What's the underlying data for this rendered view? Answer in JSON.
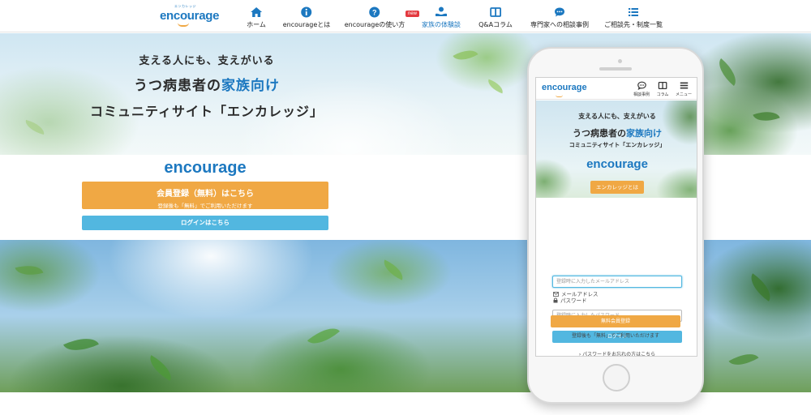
{
  "header": {
    "logo_text": "encourage",
    "logo_tagline": "エンカレッジ",
    "nav": [
      {
        "label": "ホーム",
        "icon": "home-icon"
      },
      {
        "label": "encourageとは",
        "icon": "info-icon"
      },
      {
        "label": "encourageの使い方",
        "icon": "help-icon"
      },
      {
        "label": "家族の体験談",
        "icon": "person-hand-icon",
        "badge": "new"
      },
      {
        "label": "Q&Aコラム",
        "icon": "book-icon"
      },
      {
        "label": "専門家への相談事例",
        "icon": "chat-bubble-icon"
      },
      {
        "label": "ご相談先・制度一覧",
        "icon": "list-icon"
      }
    ]
  },
  "hero": {
    "line1": "支える人にも、支えがいる",
    "line2_pre": "うつ病患者の",
    "line2_accent": "家族向け",
    "line3": "コミュニティサイト「エンカレッジ」",
    "brand": "encourage",
    "register_main": "会員登録（無料）はこちら",
    "register_sub": "登録後も「無料」でご利用いただけます",
    "login_button": "ログインはこちら"
  },
  "phone": {
    "logo_text": "encourage",
    "nav": [
      {
        "label": "相談事例",
        "icon": "chat-bubble-icon"
      },
      {
        "label": "コラム",
        "icon": "book-icon"
      },
      {
        "label": "メニュー",
        "icon": "hamburger-icon"
      }
    ],
    "hero": {
      "line1": "支える人にも、支えがいる",
      "line2_pre": "うつ病患者の",
      "line2_accent": "家族向け",
      "line3": "コミュニティサイト「エンカレッジ」",
      "brand": "encourage",
      "about_button": "エンカレッジとは"
    },
    "form": {
      "email_label": "メールアドレス",
      "email_placeholder": "登録時に入力したメールアドレス",
      "password_label": "パスワード",
      "password_placeholder": "登録時に入力したパスワード",
      "login_button": "ログイン",
      "forgot_link": "› パスワードをお忘れの方はこちら",
      "register_button": "無料会員登録",
      "register_note": "登録後も「無料」でご利用いただけます"
    }
  },
  "colors": {
    "brand_blue": "#1c78c0",
    "orange": "#f0a844",
    "login_blue": "#52b7e0",
    "new_badge": "#e3393f"
  }
}
